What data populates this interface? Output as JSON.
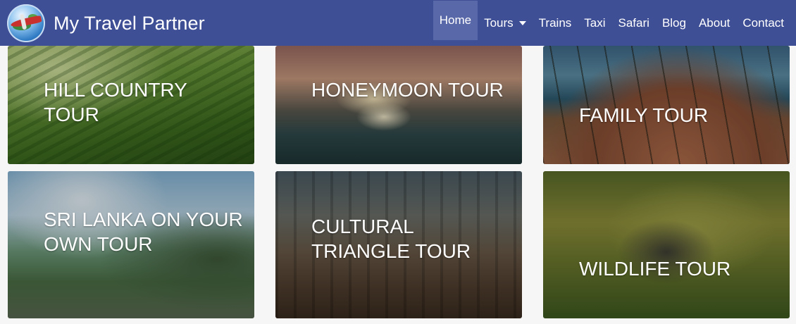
{
  "brand": {
    "name": "My Travel Partner",
    "logo_icon": "globe-airplane-logo-icon"
  },
  "nav": {
    "items": [
      {
        "label": "Home",
        "active": true
      },
      {
        "label": "Tours",
        "dropdown": true,
        "icon": "caret-down-icon"
      },
      {
        "label": "Trains"
      },
      {
        "label": "Taxi"
      },
      {
        "label": "Safari"
      },
      {
        "label": "Blog"
      },
      {
        "label": "About"
      },
      {
        "label": "Contact"
      }
    ]
  },
  "colors": {
    "navbar": "#3f4f96",
    "active_item": "#5968a9",
    "page_background": "#f6f6f6",
    "tile_text": "#ffffff"
  },
  "tours": [
    {
      "title": "HILL COUNTRY TOUR"
    },
    {
      "title": "HONEYMOON TOUR"
    },
    {
      "title": "FAMILY TOUR"
    },
    {
      "title": "SRI LANKA ON YOUR OWN TOUR"
    },
    {
      "title": "CULTURAL TRIANGLE TOUR"
    },
    {
      "title": "WILDLIFE TOUR"
    }
  ]
}
